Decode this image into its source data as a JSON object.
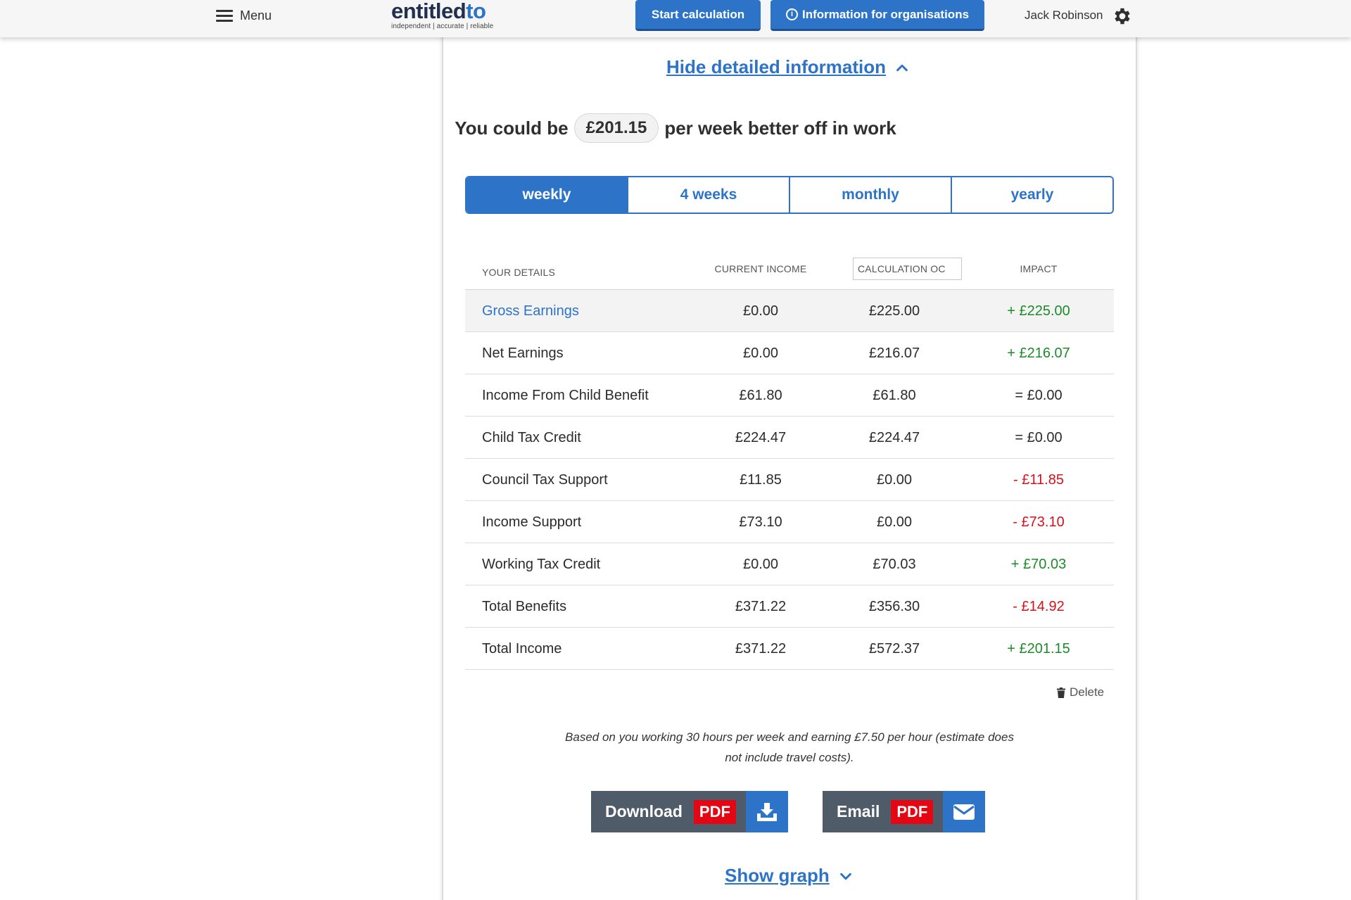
{
  "header": {
    "menu_label": "Menu",
    "logo_part1": "entitled",
    "logo_part2": "to",
    "logo_tagline": "independent | accurate | reliable",
    "start_button": "Start calculation",
    "info_button": "Information for organisations",
    "user_name": "Jack Robinson",
    "icons": {
      "menu": "hamburger-icon",
      "info": "info-icon",
      "settings": "gear-icon"
    }
  },
  "summary": {
    "hide_link": "Hide detailed information",
    "prefix": "You could be",
    "amount": "£201.15",
    "suffix": "per week better off in work"
  },
  "period_tabs": [
    {
      "label": "weekly",
      "active": true
    },
    {
      "label": "4 weeks",
      "active": false
    },
    {
      "label": "monthly",
      "active": false
    },
    {
      "label": "yearly",
      "active": false
    }
  ],
  "table": {
    "headers": {
      "details": "YOUR DETAILS",
      "current": "CURRENT INCOME",
      "calculation": "CALCULATION OC",
      "impact": "IMPACT"
    },
    "rows": [
      {
        "label": "Gross Earnings",
        "current": "£0.00",
        "calculation": "£225.00",
        "impact": "+ £225.00",
        "impact_type": "positive",
        "is_link": true,
        "highlight": true
      },
      {
        "label": "Net Earnings",
        "current": "£0.00",
        "calculation": "£216.07",
        "impact": "+ £216.07",
        "impact_type": "positive"
      },
      {
        "label": "Income From Child Benefit",
        "current": "£61.80",
        "calculation": "£61.80",
        "impact": "= £0.00",
        "impact_type": "neutral"
      },
      {
        "label": "Child Tax Credit",
        "current": "£224.47",
        "calculation": "£224.47",
        "impact": "= £0.00",
        "impact_type": "neutral"
      },
      {
        "label": "Council Tax Support",
        "current": "£11.85",
        "calculation": "£0.00",
        "impact": "- £11.85",
        "impact_type": "negative"
      },
      {
        "label": "Income Support",
        "current": "£73.10",
        "calculation": "£0.00",
        "impact": "- £73.10",
        "impact_type": "negative"
      },
      {
        "label": "Working Tax Credit",
        "current": "£0.00",
        "calculation": "£70.03",
        "impact": "+ £70.03",
        "impact_type": "positive"
      },
      {
        "label": "Total Benefits",
        "current": "£371.22",
        "calculation": "£356.30",
        "impact": "- £14.92",
        "impact_type": "negative"
      },
      {
        "label": "Total Income",
        "current": "£371.22",
        "calculation": "£572.37",
        "impact": "+ £201.15",
        "impact_type": "positive"
      }
    ]
  },
  "delete_label": "Delete",
  "note": "Based on you working 30 hours per week and earning £7.50 per hour (estimate does not include travel costs).",
  "actions": {
    "download_label": "Download",
    "email_label": "Email",
    "pdf_tag": "PDF"
  },
  "show_graph": "Show graph",
  "colors": {
    "brand_blue": "#2d73c8",
    "positive": "#1e8a2a",
    "negative": "#d4121c",
    "pdf_red": "#e40613",
    "button_grey": "#4f5b68"
  }
}
